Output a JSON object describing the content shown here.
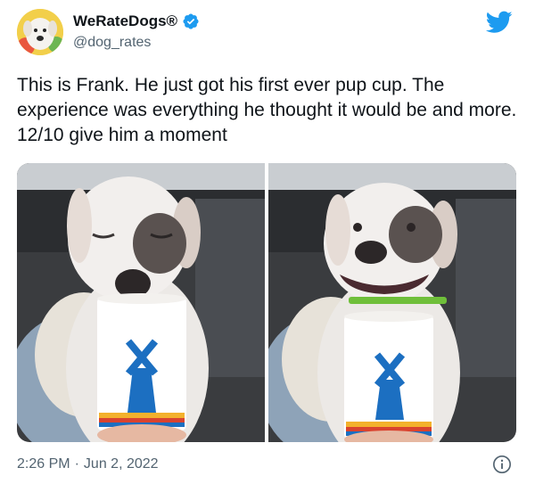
{
  "author": {
    "display_name": "WeRateDogs®",
    "handle": "@dog_rates",
    "verified": true,
    "avatar": "dog-avatar"
  },
  "brand_icon": "twitter-bird-icon",
  "tweet": {
    "text": "This is Frank. He just got his first ever pup cup. The experience was everything he thought it would be and more. 12/10 give him a moment"
  },
  "media": {
    "photos": [
      {
        "subject": "puppy-eyes-closed-with-cup"
      },
      {
        "subject": "puppy-licking-with-cup"
      }
    ]
  },
  "meta": {
    "time": "2:26 PM",
    "separator": "·",
    "date": "Jun 2, 2022",
    "info_icon": "info-icon"
  },
  "colors": {
    "twitter_blue": "#1d9bf0",
    "text_primary": "#0f1419",
    "text_secondary": "#536471",
    "cup_blue": "#1c6fc1"
  }
}
